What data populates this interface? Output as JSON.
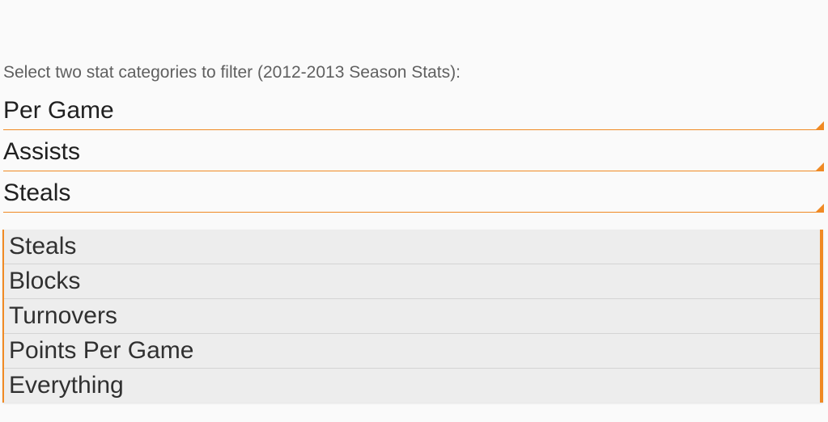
{
  "instruction": "Select two stat categories to filter (2012-2013 Season Stats):",
  "selectors": [
    {
      "value": "Per Game"
    },
    {
      "value": "Assists"
    },
    {
      "value": "Steals"
    }
  ],
  "dropdown": {
    "options": [
      "Steals",
      "Blocks",
      "Turnovers",
      "Points Per Game",
      "Everything"
    ]
  }
}
